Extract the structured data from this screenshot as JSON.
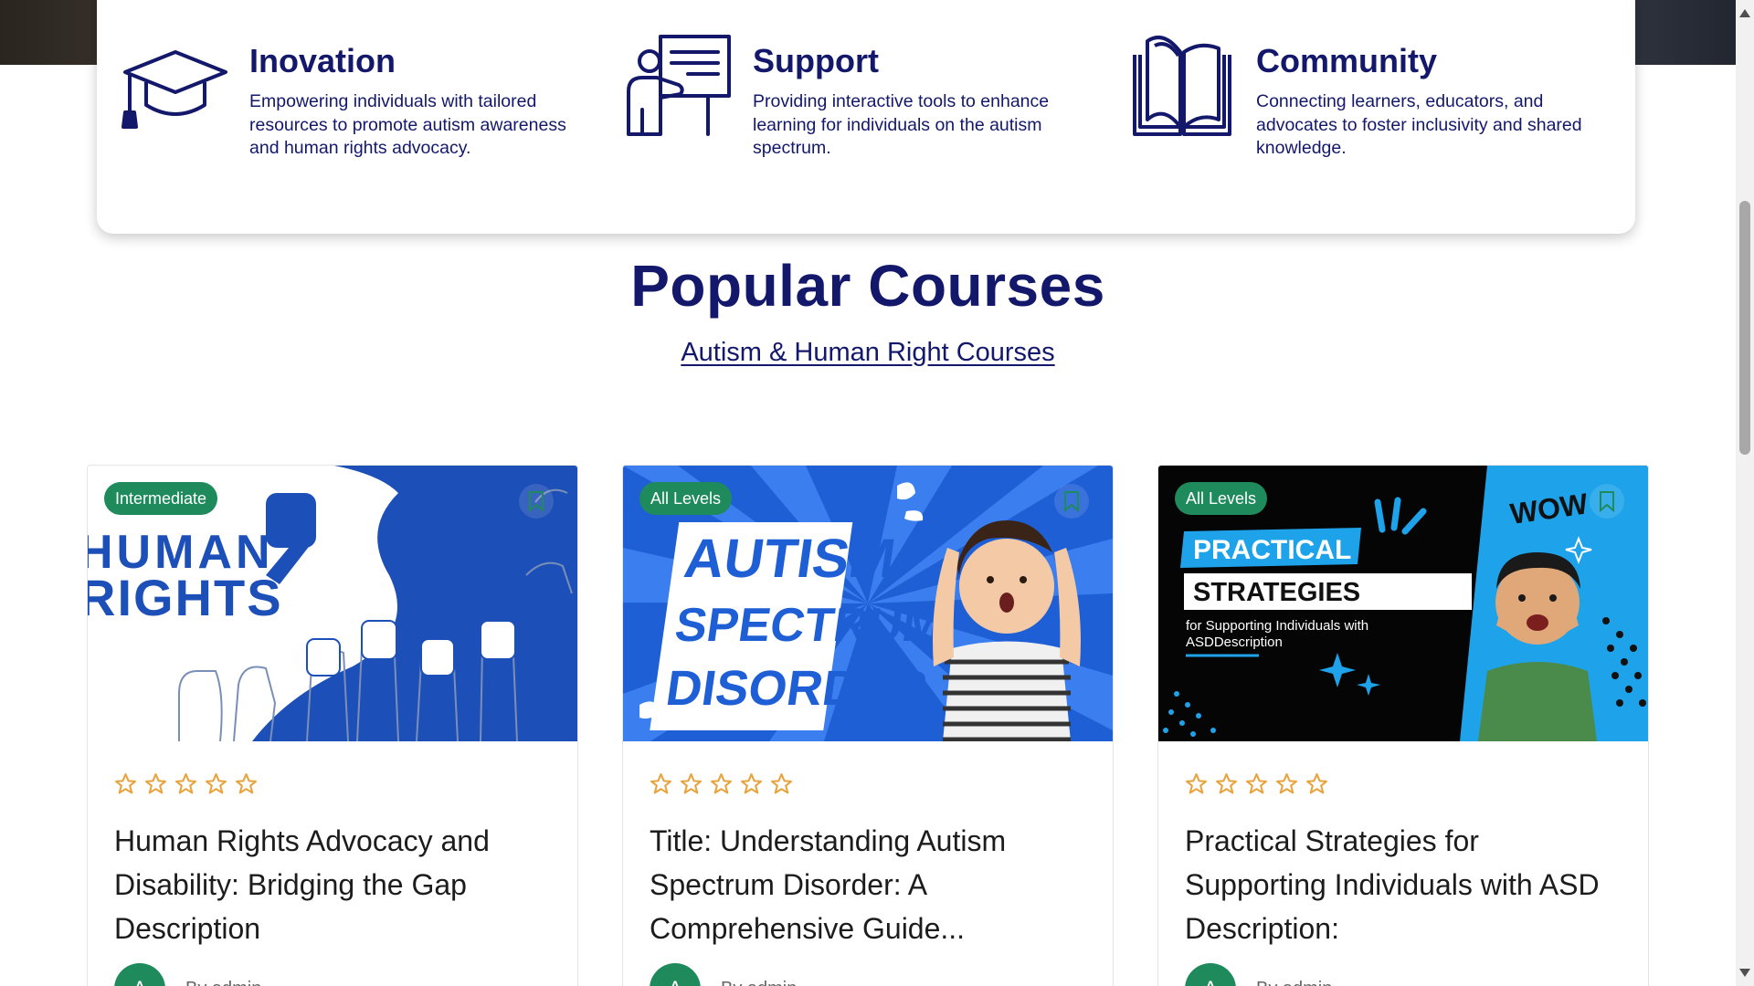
{
  "features": [
    {
      "title": "Inovation",
      "description": "Empowering individuals with tailored resources to promote autism awareness and human rights advocacy.",
      "icon": "graduation-cap-icon"
    },
    {
      "title": "Support",
      "description": "Providing interactive tools to enhance learning for individuals on the autism spectrum.",
      "icon": "teacher-board-icon"
    },
    {
      "title": "Community",
      "description": "Connecting learners, educators, and advocates to foster inclusivity and shared knowledge.",
      "icon": "open-book-icon"
    }
  ],
  "section": {
    "title": "Popular Courses",
    "link_label": "Autism & Human Right Courses"
  },
  "courses": [
    {
      "level": "Intermediate",
      "rating": 0,
      "title": "Human Rights Advocacy and Disability: Bridging the Gap Description",
      "author": "By admin",
      "avatar_letter": "A",
      "thumb_text": [
        "HUMAN",
        "RIGHTS"
      ]
    },
    {
      "level": "All Levels",
      "rating": 0,
      "title": "Title: Understanding Autism Spectrum Disorder: A Comprehensive Guide...",
      "author": "By admin",
      "avatar_letter": "A",
      "thumb_text": [
        "AUTISM",
        "SPECTRUM",
        "DISORDER"
      ]
    },
    {
      "level": "All Levels",
      "rating": 0,
      "title": "Practical Strategies for Supporting Individuals with ASD Description:",
      "author": "By admin",
      "avatar_letter": "A",
      "thumb_text": [
        "PRACTICAL",
        "STRATEGIES",
        "for Supporting Individuals with",
        "ASDDescription",
        "WOW"
      ]
    }
  ],
  "colors": {
    "brand_navy": "#13186b",
    "badge_green": "#1f8a5b",
    "star_orange": "#e8a33d"
  }
}
